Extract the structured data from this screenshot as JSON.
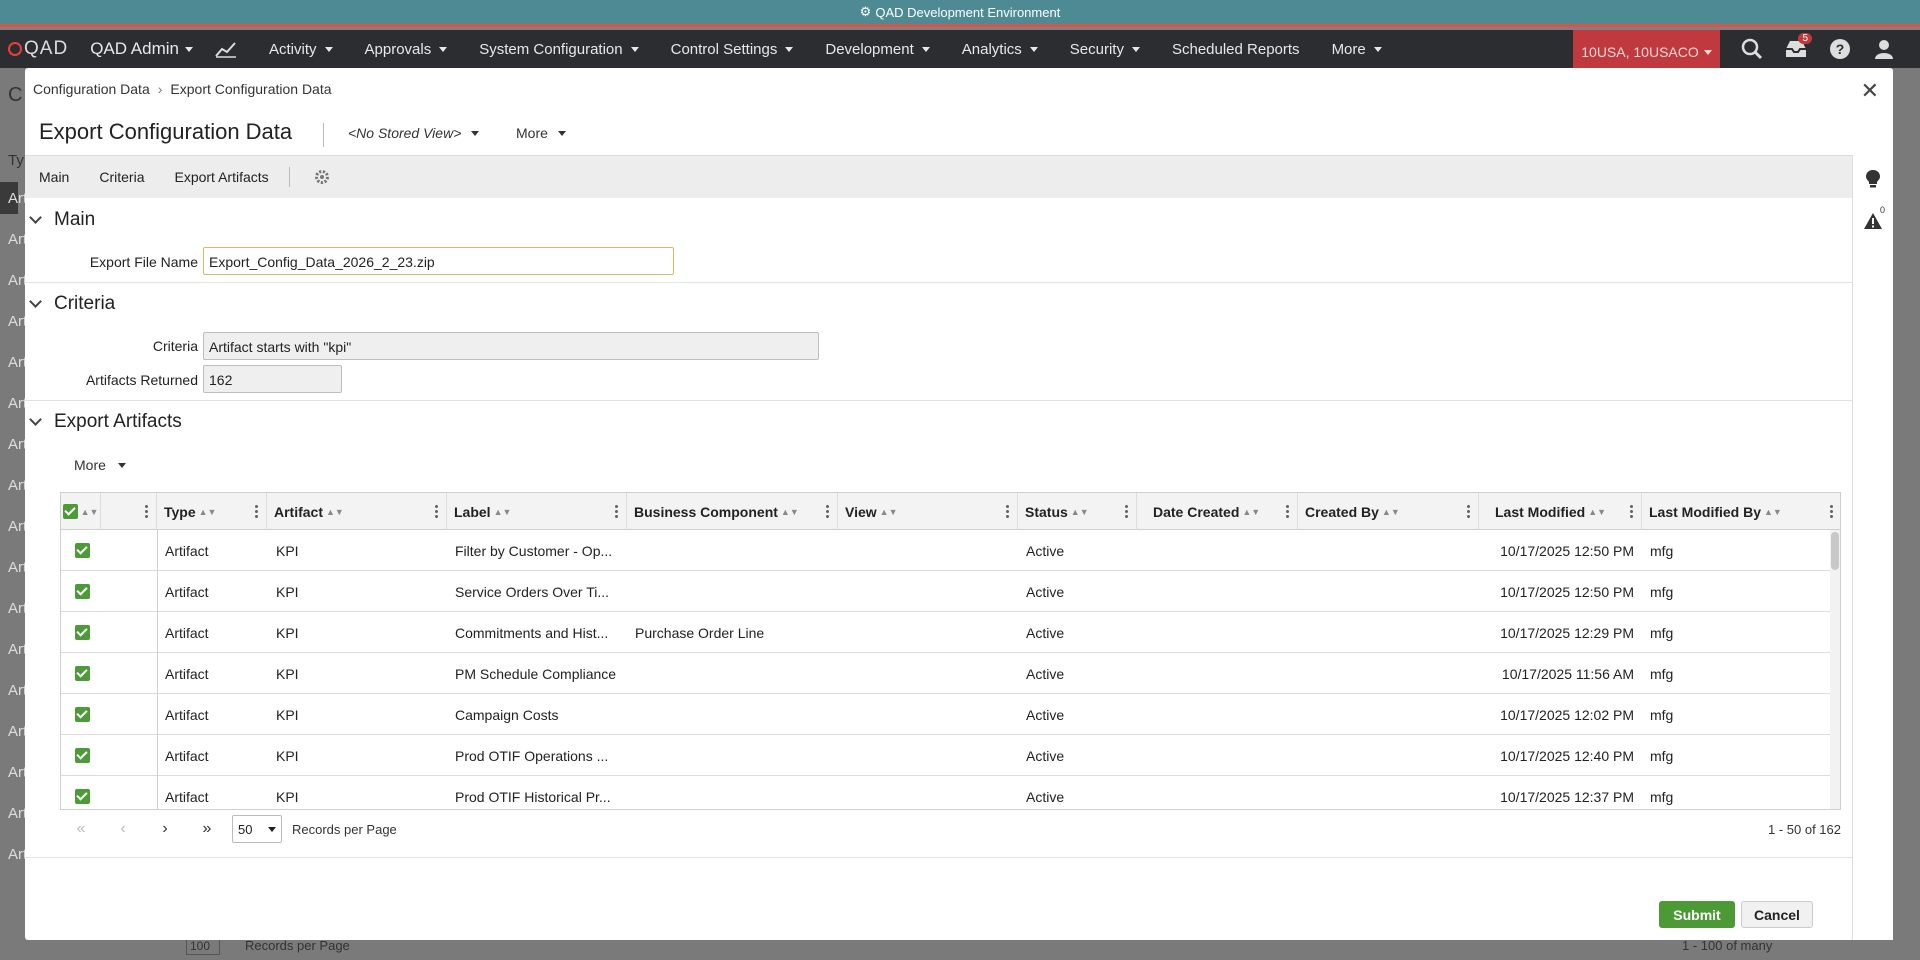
{
  "env": {
    "title": "QAD Development Environment"
  },
  "nav": {
    "logo": "QAD",
    "app": "QAD Admin",
    "items": [
      "Activity",
      "Approvals",
      "System Configuration",
      "Control Settings",
      "Development",
      "Analytics",
      "Security",
      "Scheduled Reports",
      "More"
    ],
    "domain": "10USA, 10USACO",
    "inbox_count": "5"
  },
  "background": {
    "rows": [
      "Art",
      "Art",
      "Art",
      "Art",
      "Art",
      "Art",
      "Art",
      "Art",
      "Art",
      "Art",
      "Art",
      "Art",
      "Art",
      "Art",
      "Art",
      "Art",
      "Art"
    ],
    "pager_size": "100",
    "pager_label": "Records per Page",
    "pager_count": "1 - 100 of many"
  },
  "breadcrumb": [
    "Configuration Data",
    "Export Configuration Data"
  ],
  "header": {
    "title": "Export Configuration Data",
    "view": "<No Stored View>",
    "more": "More"
  },
  "tabs": [
    "Main",
    "Criteria",
    "Export Artifacts"
  ],
  "main": {
    "section": "Main",
    "file_label": "Export File Name",
    "file_value": "Export_Config_Data_2026_2_23.zip"
  },
  "criteria": {
    "section": "Criteria",
    "criteria_label": "Criteria",
    "criteria_value": "Artifact starts with \"kpi\"",
    "returned_label": "Artifacts Returned",
    "returned_value": "162"
  },
  "artifacts": {
    "section": "Export Artifacts",
    "more": "More",
    "columns": [
      "Type",
      "Artifact",
      "Label",
      "Business Component",
      "View",
      "Status",
      "Date Created",
      "Created By",
      "Last Modified",
      "Last Modified By"
    ],
    "rows": [
      [
        "Artifact",
        "KPI",
        "Filter by Customer - Op...",
        "",
        "",
        "Active",
        "",
        "",
        "10/17/2025 12:50 PM",
        "mfg"
      ],
      [
        "Artifact",
        "KPI",
        "Service Orders Over Ti...",
        "",
        "",
        "Active",
        "",
        "",
        "10/17/2025 12:50 PM",
        "mfg"
      ],
      [
        "Artifact",
        "KPI",
        "Commitments and Hist...",
        "Purchase Order Line",
        "",
        "Active",
        "",
        "",
        "10/17/2025 12:29 PM",
        "mfg"
      ],
      [
        "Artifact",
        "KPI",
        "PM Schedule Compliance",
        "",
        "",
        "Active",
        "",
        "",
        "10/17/2025 11:56 AM",
        "mfg"
      ],
      [
        "Artifact",
        "KPI",
        "Campaign Costs",
        "",
        "",
        "Active",
        "",
        "",
        "10/17/2025 12:02 PM",
        "mfg"
      ],
      [
        "Artifact",
        "KPI",
        "Prod OTIF Operations ...",
        "",
        "",
        "Active",
        "",
        "",
        "10/17/2025 12:40 PM",
        "mfg"
      ],
      [
        "Artifact",
        "KPI",
        "Prod OTIF Historical Pr...",
        "",
        "",
        "Active",
        "",
        "",
        "10/17/2025 12:37 PM",
        "mfg"
      ]
    ],
    "page_size": "50",
    "page_label": "Records per Page",
    "count": "1 - 50 of 162"
  },
  "actions": {
    "submit": "Submit",
    "cancel": "Cancel"
  },
  "rail": {
    "alert_count": "0"
  },
  "colors": {
    "accent_green": "#4c9a36",
    "env_bar": "#4d8a94",
    "nav_bg": "#2b2d31",
    "domain_red": "#c0393e"
  }
}
